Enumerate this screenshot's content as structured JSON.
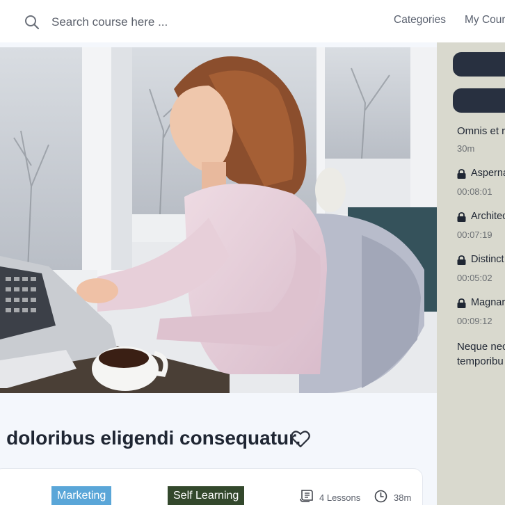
{
  "topbar": {
    "search_placeholder": "Search course here ...",
    "nav": [
      "Categories",
      "My Cours"
    ]
  },
  "course": {
    "title_visible": ": doloribus eligendi consequatur.",
    "tags": [
      "Marketing",
      "Self Learning"
    ],
    "lessons": "4 Lessons",
    "duration": "38m",
    "tag_colors": {
      "marketing": "#5aa6d8",
      "self_learning": "#33482c"
    }
  },
  "sidebar": {
    "sections": [
      {
        "title": "Omnis et r",
        "duration": "30m",
        "lessons": [
          {
            "title": "Asperna",
            "time": "00:08:01",
            "locked": true
          },
          {
            "title": "Architec",
            "time": "00:07:19",
            "locked": true
          },
          {
            "title": "Distinct",
            "time": "00:05:02",
            "locked": true
          },
          {
            "title": "Magnar",
            "time": "00:09:12",
            "locked": true
          }
        ]
      },
      {
        "title_lines": [
          "Neque nec",
          "temporibu"
        ]
      }
    ]
  },
  "icons": [
    "search-icon",
    "heart-icon",
    "lessons-icon",
    "clock-icon",
    "lock-icon"
  ]
}
